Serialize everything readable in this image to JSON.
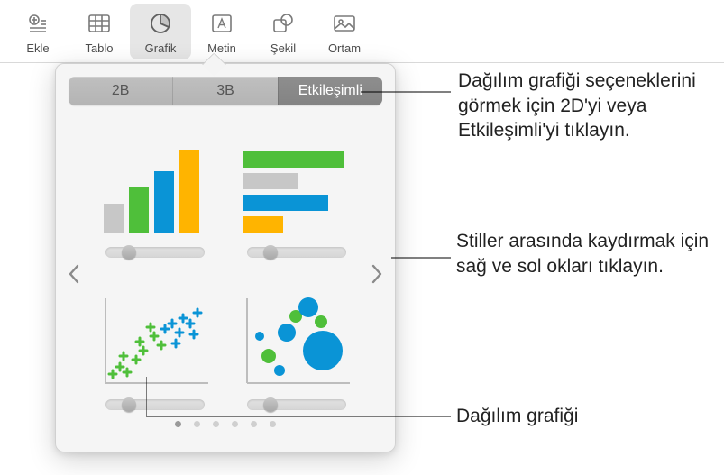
{
  "toolbar": {
    "insert": "Ekle",
    "table": "Tablo",
    "chart": "Grafik",
    "text": "Metin",
    "shape": "Şekil",
    "media": "Ortam"
  },
  "segmented": {
    "twoD": "2B",
    "threeD": "3B",
    "interactive": "Etkileşimli"
  },
  "callouts": {
    "segHint": "Dağılım grafiği seçeneklerini görmek için 2D'yi veya Etkileşimli'yi tıklayın.",
    "arrowsHint": "Stiller arasında kaydırmak için sağ ve sol okları tıklayın.",
    "scatterLabel": "Dağılım grafiği"
  },
  "thumbs": {
    "t1": "column-chart-icon",
    "t2": "bar-chart-icon",
    "t3": "scatter-chart-icon",
    "t4": "bubble-chart-icon"
  },
  "colors": {
    "green": "#4fbf3a",
    "blue": "#0a94d6",
    "yellow": "#ffb400",
    "gray": "#c7c7c7"
  },
  "pagination": {
    "count": 6,
    "current": 0
  }
}
